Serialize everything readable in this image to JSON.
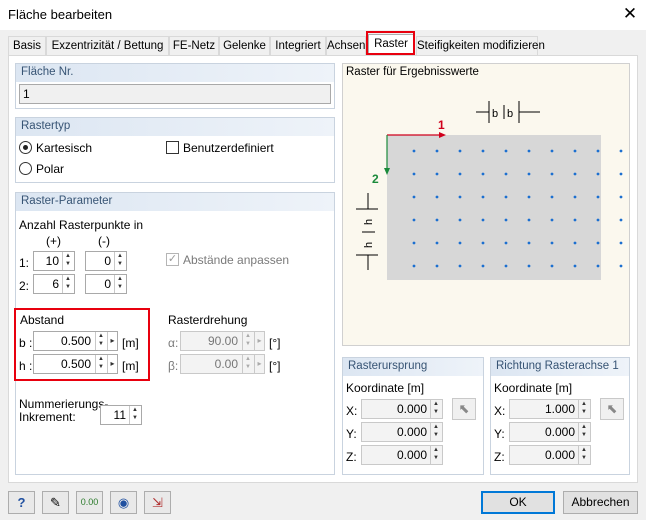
{
  "window": {
    "title": "Fläche bearbeiten"
  },
  "tabs": [
    "Basis",
    "Exzentrizität / Bettung",
    "FE-Netz",
    "Gelenke",
    "Integriert",
    "Achsen",
    "Raster",
    "Steifigkeiten modifizieren"
  ],
  "flaeche_nr": {
    "heading": "Fläche Nr.",
    "value": "1"
  },
  "rastertyp": {
    "heading": "Rastertyp",
    "options": [
      "Kartesisch",
      "Polar"
    ],
    "selected": "Kartesisch",
    "benutzerdefiniert": "Benutzerdefiniert"
  },
  "parameter": {
    "heading": "Raster-Parameter",
    "anzahl_label": "Anzahl Rasterpunkte in",
    "plus": "(+)",
    "minus": "(-)",
    "row1_label": "1:",
    "row2_label": "2:",
    "r1_plus": "10",
    "r1_minus": "0",
    "r2_plus": "6",
    "r2_minus": "0",
    "abstaende_anpassen": "Abstände anpassen",
    "abstand_label": "Abstand",
    "b_label": "b :",
    "b_value": "0.500",
    "b_unit": "[m]",
    "h_label": "h :",
    "h_value": "0.500",
    "h_unit": "[m]",
    "rasterdrehung_label": "Rasterdrehung",
    "alpha_label": "α:",
    "alpha_value": "90.00",
    "beta_label": "β:",
    "beta_value": "0.00",
    "deg_unit": "[°]",
    "nummerierung_label_1": "Nummerierungs-",
    "nummerierung_label_2": "Inkrement:",
    "nummerierung_value": "11"
  },
  "preview": {
    "heading": "Raster für Ergebnisswerte",
    "axis1": "1",
    "axis2": "2",
    "b": "b",
    "h": "h"
  },
  "ursprung": {
    "heading": "Rasterursprung",
    "koordinate": "Koordinate [m]",
    "x_label": "X:",
    "x": "0.000",
    "y_label": "Y:",
    "y": "0.000",
    "z_label": "Z:",
    "z": "0.000"
  },
  "richtung": {
    "heading": "Richtung Rasterachse 1",
    "koordinate": "Koordinate [m]",
    "x_label": "X:",
    "x": "1.000",
    "y_label": "Y:",
    "y": "0.000",
    "z_label": "Z:",
    "z": "0.000"
  },
  "footer": {
    "ok": "OK",
    "cancel": "Abbrechen",
    "icons": [
      "help-icon",
      "edit-icon",
      "units-icon",
      "view-icon",
      "export-icon"
    ]
  },
  "colors": {
    "highlight": "#e8000e",
    "axis1": "#d0001c",
    "axis2": "#1a8a3a",
    "dots": "#1c6fd0"
  }
}
